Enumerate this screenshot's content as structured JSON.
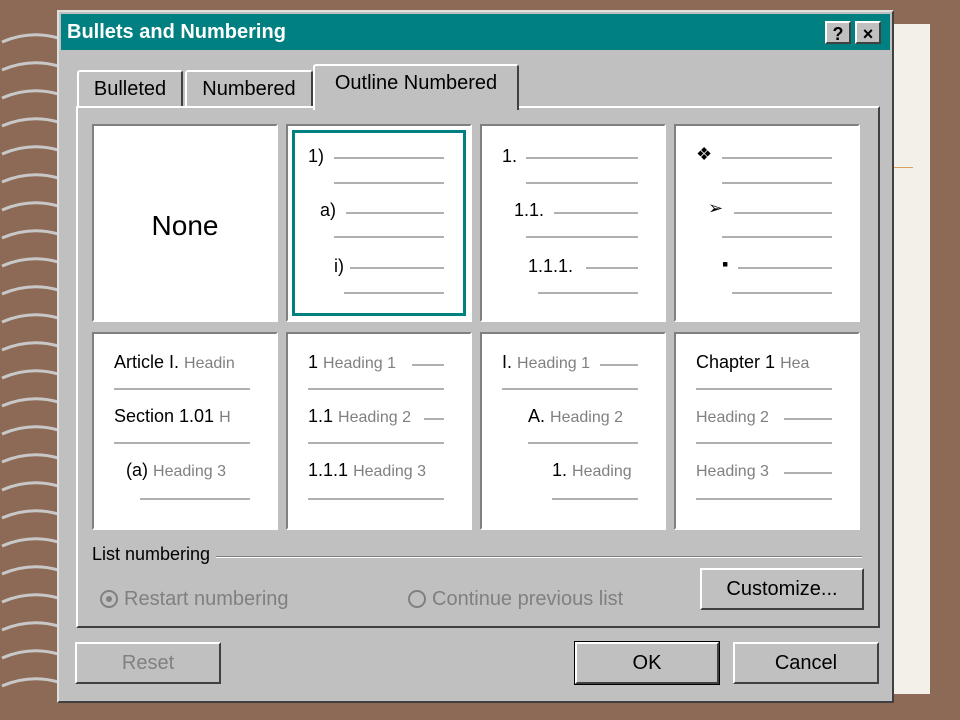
{
  "window": {
    "title": "Bullets and Numbering",
    "help_label": "?",
    "close_label": "×"
  },
  "tabs": [
    {
      "label": "Bulleted",
      "active": false
    },
    {
      "label": "Numbered",
      "active": false
    },
    {
      "label": "Outline Numbered",
      "active": true
    }
  ],
  "styles": {
    "none_label": "None",
    "c1": {
      "l1": "1)",
      "l2": "a)",
      "l3": "i)"
    },
    "c2": {
      "l1": "1.",
      "l2": "1.1.",
      "l3": "1.1.1."
    },
    "c3": {
      "l1": "❖",
      "l2": "➢",
      "l3": "▪"
    },
    "c4": {
      "l1a": "Article I.",
      "l1b": "Headin",
      "l2a": "Section 1.01",
      "l2b": "H",
      "l3a": "(a)",
      "l3b": "Heading 3"
    },
    "c5": {
      "l1a": "1",
      "l1b": "Heading 1",
      "l2a": "1.1",
      "l2b": "Heading 2",
      "l3a": "1.1.1",
      "l3b": "Heading 3"
    },
    "c6": {
      "l1a": "I.",
      "l1b": "Heading 1",
      "l2a": "A.",
      "l2b": "Heading 2",
      "l3a": "1.",
      "l3b": "Heading"
    },
    "c7": {
      "l1a": "Chapter 1",
      "l1b": "Hea",
      "l2b": "Heading 2",
      "l3b": "Heading 3"
    }
  },
  "list_numbering": {
    "label": "List numbering",
    "restart": "Restart numbering",
    "continue": "Continue previous list",
    "customize": "Customize..."
  },
  "buttons": {
    "reset": "Reset",
    "ok": "OK",
    "cancel": "Cancel"
  }
}
